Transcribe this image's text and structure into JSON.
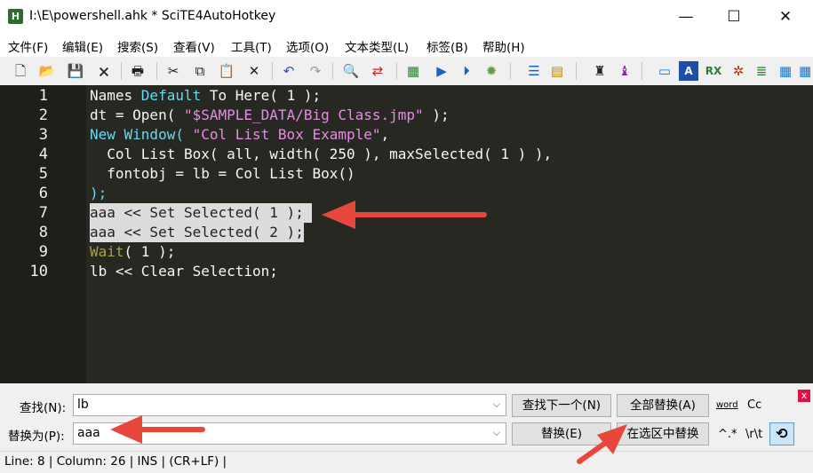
{
  "window": {
    "title": "I:\\E\\powershell.ahk * SciTE4AutoHotkey",
    "icon": "app-icon",
    "controls": [
      "minimize-icon",
      "maximize-icon",
      "close-icon"
    ],
    "control_glyphs": {
      "minimize": "—",
      "maximize": "☐",
      "close": "✕"
    }
  },
  "menu": [
    "文件(F)",
    "编辑(E)",
    "搜索(S)",
    "查看(V)",
    "工具(T)",
    "选项(O)",
    "文本类型(L)",
    "标签(B)",
    "帮助(H)"
  ],
  "toolbar": {
    "icons": [
      "new-file-icon",
      "open-file-icon",
      "save-icon",
      "close-file-icon",
      "print-icon",
      "cut-icon",
      "copy-icon",
      "paste-icon",
      "delete-icon",
      "undo-icon",
      "redo-icon",
      "find-icon",
      "replace-icon",
      "compile-icon",
      "run-icon",
      "debug-run-icon",
      "bug-icon",
      "abbrev-icon",
      "properties-icon",
      "user1-icon",
      "user2-icon",
      "window-icon",
      "a-icon",
      "rx-icon",
      "spider-icon",
      "list-icon",
      "grid-icon",
      "app-grid-icon"
    ]
  },
  "editor": {
    "background": "#272822",
    "line_numbers": [
      "1",
      "2",
      "3",
      "4",
      "5",
      "6",
      "7",
      "8",
      "9",
      "10"
    ],
    "lines": {
      "l1": {
        "a": "Names ",
        "b": "Default",
        "c": " To Here",
        "d": "( 1 );"
      },
      "l2": {
        "a": "dt = Open( ",
        "b": "\"$SAMPLE_DATA/Big Class.jmp\"",
        "c": " );"
      },
      "l3": {
        "a": "New Window( ",
        "b": "\"Col List Box Example\"",
        "c": ","
      },
      "l4": {
        "a": "  Col List Box( all, width( 250 ), maxSelected( 1 ) ),"
      },
      "l5": {
        "a": "  fontobj = lb = Col List Box()"
      },
      "l6": {
        "a": ");"
      },
      "l7": {
        "a": "aaa << Set Selected( 1 ); "
      },
      "l8": {
        "a": "aaa << Set Selected( 2 );"
      },
      "l9": {
        "a": "Wait",
        "b": "( 1 );"
      },
      "l10": {
        "a": "lb << Clear Selection;"
      }
    }
  },
  "find": {
    "find_label": "查找(N):",
    "find_value": "lb",
    "replace_label": "替换为(P):",
    "replace_value": "aaa",
    "find_next_button": "查找下一个(N)",
    "replace_all_button": "全部替换(A)",
    "replace_button": "替换(E)",
    "replace_in_selection_button": "在选区中替换",
    "opt_word": "word",
    "opt_case": "Cc",
    "opt_regex": "^.*",
    "opt_escape": "\\r\\t",
    "wrap_glyph": "⟲",
    "close_glyph": "x"
  },
  "status": {
    "text": "Line: 8 | Column: 26 | INS | (CR+LF) |"
  },
  "annotations": {
    "arrow_color": "#e8483b"
  }
}
